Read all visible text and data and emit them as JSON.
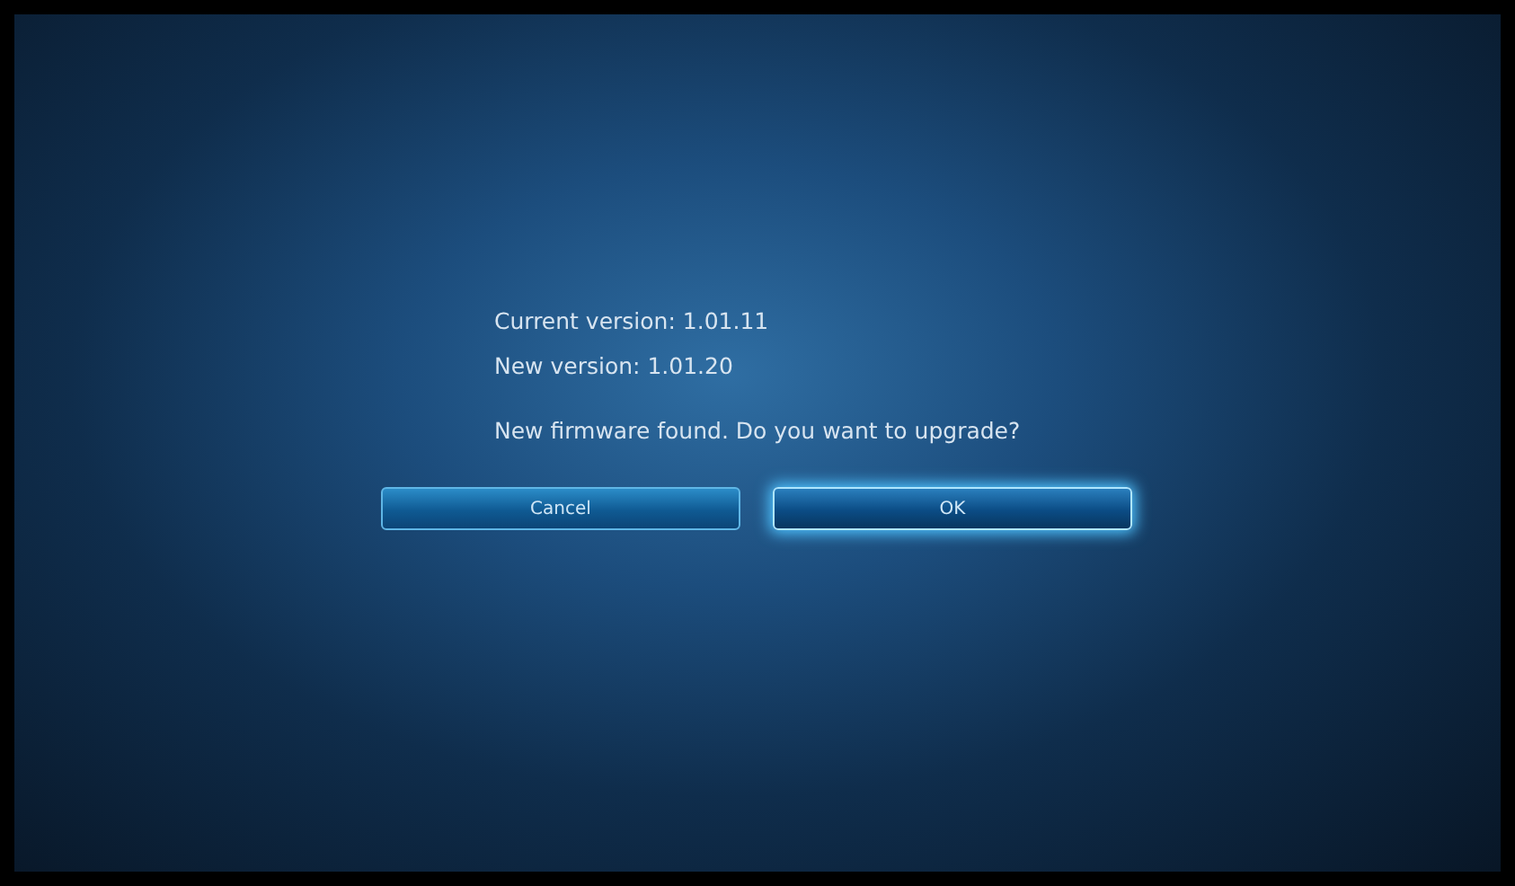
{
  "dialog": {
    "lines": [
      "Current version: 1.01.11",
      "New version: 1.01.20"
    ],
    "message": "New firmware found. Do you want to upgrade?",
    "buttons": [
      {
        "label": "Cancel",
        "selected": false
      },
      {
        "label": "OK",
        "selected": true
      }
    ]
  }
}
